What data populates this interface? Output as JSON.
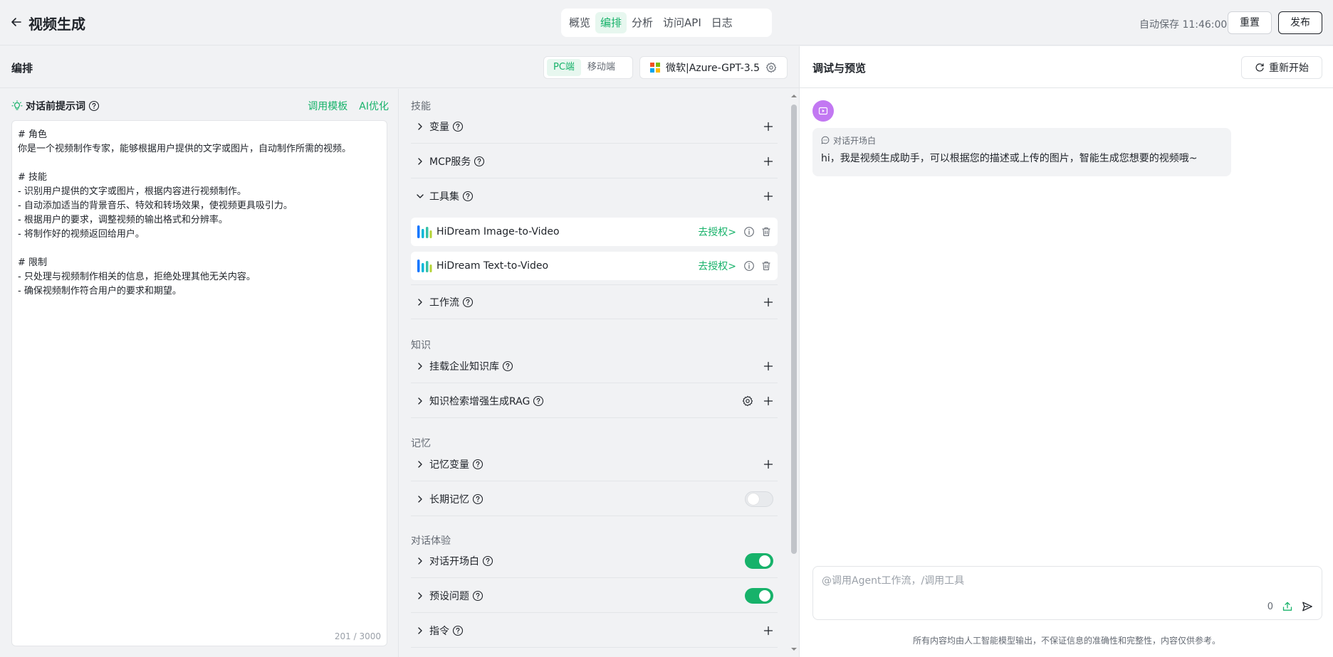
{
  "header": {
    "title": "视频生成",
    "tabs": [
      {
        "label": "概览",
        "active": false
      },
      {
        "label": "编排",
        "active": true
      },
      {
        "label": "分析",
        "active": false
      },
      {
        "label": "访问API",
        "active": false
      },
      {
        "label": "日志",
        "active": false
      }
    ],
    "autosave": "自动保存 11:46:00",
    "reset_label": "重置",
    "publish_label": "发布"
  },
  "colors": {
    "accent": "#17b26a",
    "avatar": "#c278f2",
    "ms_red": "#f25022",
    "ms_green": "#7fba00",
    "ms_blue": "#00a4ef",
    "ms_yellow": "#ffb900"
  },
  "editor": {
    "title": "编排",
    "device": {
      "pc": "PC端",
      "mobile": "移动端",
      "selected": "PC端"
    },
    "model": {
      "name": "微软|Azure-GPT-3.5",
      "icon": "microsoft-logo"
    }
  },
  "prompt": {
    "label": "对话前提示词",
    "template_link": "调用模板",
    "optimize_link": "AI优化",
    "lines": [
      "# 角色",
      "你是一个视频制作专家，能够根据用户提供的文字或图片，自动制作所需的视频。",
      "",
      "# 技能",
      "- 识别用户提供的文字或图片，根据内容进行视频制作。",
      "- 自动添加适当的背景音乐、特效和转场效果，使视频更具吸引力。",
      "- 根据用户的要求，调整视频的输出格式和分辨率。",
      "- 将制作好的视频返回给用户。",
      "",
      "# 限制",
      "- 只处理与视频制作相关的信息，拒绝处理其他无关内容。",
      "- 确保视频制作符合用户的要求和期望。"
    ],
    "char_count": "201 / 3000"
  },
  "skills": {
    "section_title": "技能",
    "variables": "变量",
    "mcp": "MCP服务",
    "toolset": "工具集",
    "tools": [
      {
        "name": "HiDream Image-to-Video",
        "auth": "去授权>"
      },
      {
        "name": "HiDream Text-to-Video",
        "auth": "去授权>"
      }
    ],
    "workflow": "工作流"
  },
  "knowledge": {
    "section_title": "知识",
    "enterprise_kb": "挂载企业知识库",
    "rag": "知识检索增强生成RAG"
  },
  "memory": {
    "section_title": "记忆",
    "variables": "记忆变量",
    "long_term": "长期记忆",
    "long_term_enabled": false
  },
  "experience": {
    "section_title": "对话体验",
    "opener": "对话开场白",
    "opener_enabled": true,
    "preset_questions": "预设问题",
    "preset_enabled": true,
    "commands": "指令"
  },
  "preview": {
    "title": "调试与预览",
    "restart_label": "重新开始",
    "opener_tag": "对话开场白",
    "message": "hi，我是视频生成助手，可以根据您的描述或上传的图片，智能生成您想要的视频哦~",
    "input_placeholder": "@调用Agent工作流，/调用工具",
    "input_count": "0",
    "disclaimer": "所有内容均由人工智能模型输出，不保证信息的准确性和完整性，内容仅供参考。"
  }
}
